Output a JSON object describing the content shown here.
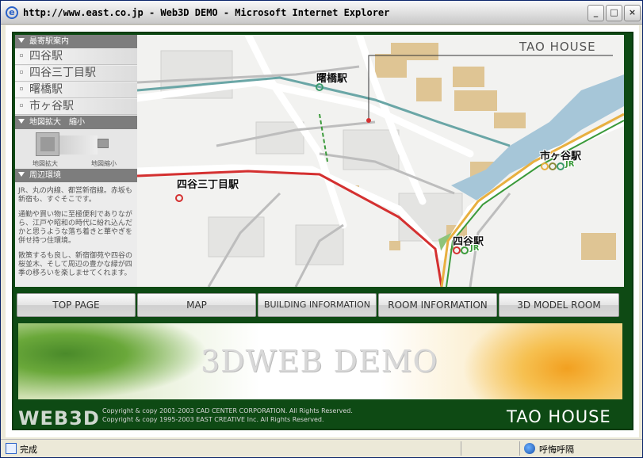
{
  "window": {
    "title": "http://www.east.co.jp - Web3D DEMO - Microsoft Internet Explorer",
    "minimize": "_",
    "maximize": "□",
    "close": "×"
  },
  "sidebar": {
    "stations_header": "最寄駅案内",
    "stations": [
      "四谷駅",
      "四谷三丁目駅",
      "曙橋駅",
      "市ヶ谷駅"
    ],
    "zoom_header": "地図拡大　縮小",
    "zoom_in_label": "地図拡大",
    "zoom_out_label": "地図縮小",
    "env_header": "周辺環境",
    "env_paragraphs": [
      "JR、丸の内線、都営新宿線。赤坂も新宿も、すぐそこです。",
      "通勤や買い物に至極便利でありながら、江戸や昭和の時代に紛れ込んだかと思うような落ち着きと華やぎを併せ持つ住環境。",
      "散策するも良し、新宿御苑や四谷の桜並木、そして周辺の豊かな緑が四季の移ろいを楽しませてくれます。"
    ]
  },
  "map": {
    "logo": "TAO HOUSE",
    "station_labels": {
      "akebonobashi": "曙橋駅",
      "ichigaya": "市ヶ谷駅",
      "yotsuya3": "四谷三丁目駅",
      "yotsuya": "四谷駅"
    },
    "jr_mark": "JR"
  },
  "nav": {
    "items": [
      "TOP PAGE",
      "MAP",
      "BUILDING INFORMATION",
      "ROOM INFORMATION",
      "3D MODEL ROOM"
    ]
  },
  "banner": {
    "title": "3DWEB DEMO"
  },
  "footer": {
    "brand": "WEB3D",
    "copyright_1": "Copyright & copy 2001-2003 CAD CENTER CORPORATION. All Rights Reserved.",
    "copyright_2": "Copyright & copy 1995-2003 EAST CREATIVE Inc. All Rights Reserved.",
    "logo": "TAO HOUSE"
  },
  "status": {
    "text": "完成",
    "zone": "呼悔呼隔"
  },
  "colors": {
    "site_green": "#0e4a14",
    "jr_green": "#3a9a3a",
    "rail_red": "#d43030",
    "teal_line": "#6aa6a6"
  }
}
